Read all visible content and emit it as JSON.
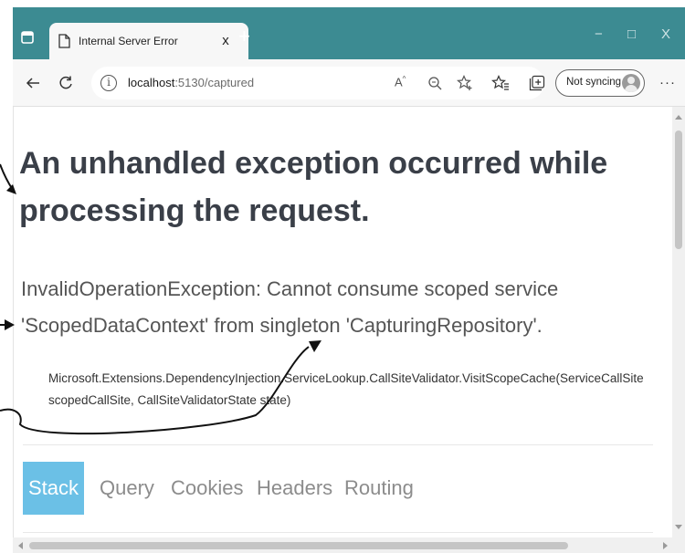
{
  "browser": {
    "tab": {
      "title": "Internal Server Error",
      "close_label": "x"
    },
    "new_tab_label": "+",
    "window_controls": {
      "minimize": "−",
      "maximize": "□",
      "close": "X"
    },
    "address": {
      "host": "localhost",
      "port_path": ":5130/captured"
    },
    "sync_label": "Not syncing",
    "more_label": "···",
    "theme_color": "#3c8b92"
  },
  "page": {
    "heading": "An unhandled exception occurred while processing the request.",
    "message": "InvalidOperationException: Cannot consume scoped service 'ScopedDataContext' from singleton 'CapturingRepository'.",
    "location": "Microsoft.Extensions.DependencyInjection.ServiceLookup.CallSiteValidator.VisitScopeCache(ServiceCallSite scopedCallSite, CallSiteValidatorState state)",
    "tabs": [
      {
        "label": "Stack",
        "selected": true
      },
      {
        "label": "Query",
        "selected": false
      },
      {
        "label": "Cookies",
        "selected": false
      },
      {
        "label": "Headers",
        "selected": false
      },
      {
        "label": "Routing",
        "selected": false
      }
    ],
    "selected_tab_color": "#6bc0e6"
  },
  "icons": [
    "window-icon",
    "document-icon",
    "back-icon",
    "refresh-icon",
    "info-icon",
    "read-aloud-icon",
    "zoom-icon",
    "add-favorite-icon",
    "favorites-icon",
    "collections-icon",
    "avatar-icon",
    "more-icon",
    "annotation-arrow-icon"
  ]
}
